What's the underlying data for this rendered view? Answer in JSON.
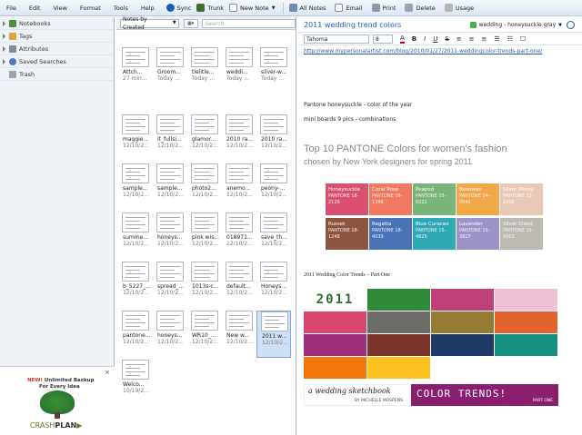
{
  "menu": [
    "File",
    "Edit",
    "View",
    "Format",
    "Tools",
    "Help"
  ],
  "toolbar": {
    "sync": "Sync",
    "trunk": "Trunk",
    "new_note": "New Note",
    "all_notes": "All Notes",
    "email": "Email",
    "print": "Print",
    "delete": "Delete",
    "usage": "Usage"
  },
  "sidebar": {
    "items": [
      "Notebooks",
      "Tags",
      "Attributes",
      "Saved Searches",
      "Trash"
    ]
  },
  "ad": {
    "line1_accent": "NEW!",
    "line1": "Unlimited Backup",
    "line2": "For Every Idea",
    "logo_a": "CRASH",
    "logo_b": "PLAN"
  },
  "list": {
    "sort": "Notes by Created",
    "search_placeholder": "Search",
    "notes": [
      {
        "title": "Attch...",
        "date": "27 min..."
      },
      {
        "title": "Groom...",
        "date": "Today ..."
      },
      {
        "title": "tlelitle...",
        "date": "Today ..."
      },
      {
        "title": "weddi...",
        "date": "Today ..."
      },
      {
        "title": "silver-w...",
        "date": "Today ..."
      },
      {
        "title": "maggie...",
        "date": "12/10/2..."
      },
      {
        "title": "it_fullsi...",
        "date": "12/10/2..."
      },
      {
        "title": "glamor...",
        "date": "12/10/2..."
      },
      {
        "title": "2010 ra...",
        "date": "12/10/2..."
      },
      {
        "title": "2010 ra...",
        "date": "12/10/2..."
      },
      {
        "title": "sample...",
        "date": "12/10/2..."
      },
      {
        "title": "sample...",
        "date": "12/10/2..."
      },
      {
        "title": "photo2...",
        "date": "12/10/2..."
      },
      {
        "title": "anemo...",
        "date": "12/10/2..."
      },
      {
        "title": "peony-...",
        "date": "12/10/2..."
      },
      {
        "title": "summe...",
        "date": "12/10/2..."
      },
      {
        "title": "honeys...",
        "date": "12/10/2..."
      },
      {
        "title": "pink wis...",
        "date": "12/10/2..."
      },
      {
        "title": "018971...",
        "date": "12/10/2..."
      },
      {
        "title": "save_th...",
        "date": "12/10/2..."
      },
      {
        "title": "b_5227_...",
        "date": "12/10/2..."
      },
      {
        "title": "spread_...",
        "date": "12/10/2..."
      },
      {
        "title": "1013s-c...",
        "date": "12/10/2..."
      },
      {
        "title": "default...",
        "date": "12/10/2..."
      },
      {
        "title": "Honeys...",
        "date": "12/10/2..."
      },
      {
        "title": "pantone...",
        "date": "12/10/2..."
      },
      {
        "title": "honeys...",
        "date": "12/10/2..."
      },
      {
        "title": "WR10_...",
        "date": "12/10/2..."
      },
      {
        "title": "New w...",
        "date": "12/10/2..."
      },
      {
        "title": "2011 w...",
        "date": "12/10/2..."
      },
      {
        "title": "Welco...",
        "date": "10/19/2..."
      }
    ]
  },
  "note": {
    "title": "2011 wedding trend colors",
    "notebook": "wedding - honeysuckle gray",
    "font": "Tahoma",
    "size": "8",
    "link": "http://www.mypersonalartist.com/blog/2010/01/27/2011-weddingcolor-trends-part-one/",
    "line1": "Pantone honeysuckle - color of the year",
    "line2": "mini boards 9 pics - combinations",
    "img1_title": "Top 10 PANTONE Colors for women's fashion",
    "img1_sub": "chosen by New York designers for spring 2011",
    "swatches": [
      {
        "name": "Honeysuckle",
        "code": "PANTONE 18-2120",
        "color": "#d94f70"
      },
      {
        "name": "Coral Rose",
        "code": "PANTONE 16-1349",
        "color": "#f0795f"
      },
      {
        "name": "Peapod",
        "code": "PANTONE 15-6322",
        "color": "#79b47a"
      },
      {
        "name": "Beeswax",
        "code": "PANTONE 14-0941",
        "color": "#f2a848"
      },
      {
        "name": "Silver Peony",
        "code": "PANTONE 12-1206",
        "color": "#e9c9b6"
      },
      {
        "name": "Russet",
        "code": "PANTONE 18-1248",
        "color": "#8c553f"
      },
      {
        "name": "Regatta",
        "code": "PANTONE 18-4039",
        "color": "#4a72b6"
      },
      {
        "name": "Blue Curacao",
        "code": "PANTONE 15-4825",
        "color": "#2fa8b6"
      },
      {
        "name": "Lavender",
        "code": "PANTONE 15-3817",
        "color": "#9c94c8"
      },
      {
        "name": "Silver Cloud",
        "code": "PANTONE 15-4503",
        "color": "#bdbab3"
      }
    ],
    "caption": "2011 Wedding Color Trends – Part One",
    "year": "2011",
    "blocks": [
      "#2f8a3a",
      "#c0407a",
      "#efc0d6",
      "#d9466f",
      "#6e6c68",
      "#967b33",
      "#e2632f",
      "#9e2e78",
      "#7b3429",
      "#1f3a66",
      "#15907e",
      "#f2760d",
      "#fbc220"
    ],
    "banner_left": "a wedding sketchbook",
    "banner_left_sub": "BY MICHELLE MOSPENS",
    "banner_right": "COLOR TRENDS!",
    "banner_right_sub": "PART ONE"
  }
}
